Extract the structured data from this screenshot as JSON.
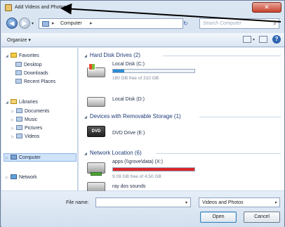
{
  "window": {
    "title": "Add Videos and Photos",
    "close_glyph": "✕"
  },
  "nav": {
    "back_glyph": "◀",
    "forward_glyph": "▶",
    "recent_glyph": "▾",
    "address_sep": "▸",
    "address_crumb": "Computer",
    "refresh_glyph": "↻",
    "search_placeholder": "Search Computer",
    "search_glyph": "⌕"
  },
  "toolbar": {
    "organize_label": "Organize ▾",
    "help_glyph": "?"
  },
  "sidebar": {
    "favorites": {
      "label": "Favorites",
      "items": [
        "Desktop",
        "Downloads",
        "Recent Places"
      ]
    },
    "libraries": {
      "label": "Libraries",
      "items": [
        "Documents",
        "Music",
        "Pictures",
        "Videos"
      ]
    },
    "computer": {
      "label": "Computer"
    },
    "network": {
      "label": "Network"
    }
  },
  "content": {
    "groups": {
      "hdd": {
        "label": "Hard Disk Drives (2)"
      },
      "removable": {
        "label": "Devices with Removable Storage (1)"
      },
      "network": {
        "label": "Network Location (6)"
      }
    },
    "drives": {
      "c": {
        "name": "Local Disk (C:)",
        "free": "180 GB free of 210 GB",
        "used_fraction": 0.14,
        "bar_color": "#2b8cd6"
      },
      "d": {
        "name": "Local Disk (D:)"
      },
      "dvd": {
        "name": "DVD Drive (E:)",
        "badge": "DVD"
      },
      "net1": {
        "name": "apps (\\\\grove\\data) (X:)",
        "free": "9.09 GB free of 4.50 GB",
        "used_fraction": 1.0,
        "bar_color": "#d8262a"
      },
      "net2": {
        "name": "ray dos sounds"
      }
    }
  },
  "footer": {
    "file_name_label": "File name:",
    "file_name_value": "",
    "filter_value": "Videos and Photos",
    "drop_glyph": "▾",
    "open_label": "Open",
    "cancel_label": "Cancel"
  },
  "colors": {
    "accent": "#2b8cd6",
    "warning_bar": "#d8262a",
    "annotation": "#000000"
  }
}
